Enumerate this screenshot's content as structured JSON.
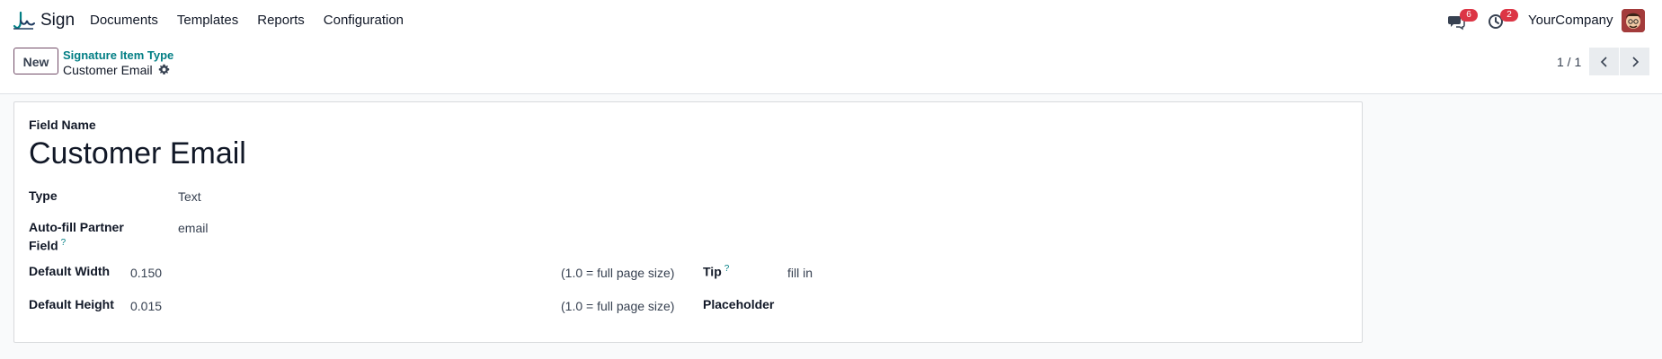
{
  "navbar": {
    "app_name": "Sign",
    "menu": [
      "Documents",
      "Templates",
      "Reports",
      "Configuration"
    ],
    "messages_badge": "6",
    "activities_badge": "2",
    "company": "YourCompany"
  },
  "control_panel": {
    "new_button": "New",
    "breadcrumb_parent": "Signature Item Type",
    "record_title": "Customer Email",
    "pager": "1 / 1"
  },
  "form": {
    "field_name_label": "Field Name",
    "field_name_value": "Customer Email",
    "type_label": "Type",
    "type_value": "Text",
    "autofill_label_line1": "Auto-fill Partner",
    "autofill_label_line2": "Field",
    "autofill_value": "email",
    "default_width_label": "Default Width",
    "default_width_value": "0.150",
    "default_width_hint": "(1.0 = full page size)",
    "default_height_label": "Default Height",
    "default_height_value": "0.015",
    "default_height_hint": "(1.0 = full page size)",
    "tip_label": "Tip",
    "tip_value": "fill in",
    "placeholder_label": "Placeholder",
    "help_mark": "?"
  },
  "colors": {
    "brand": "#714B67",
    "link": "#017e84",
    "badge": "#dc3545"
  }
}
